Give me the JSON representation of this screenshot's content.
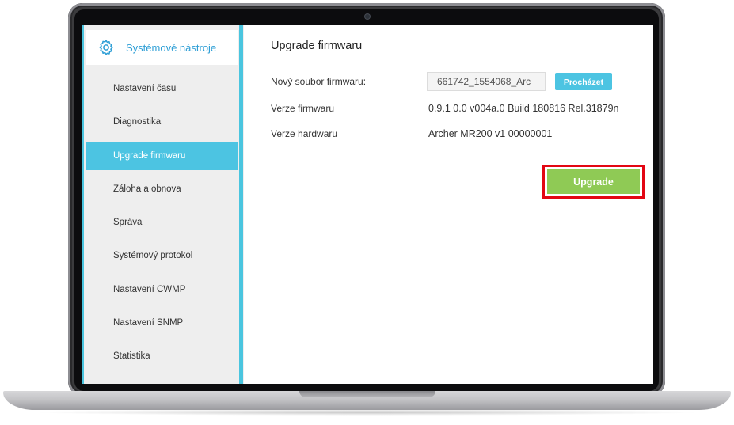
{
  "sidebar": {
    "header_title": "Systémové nástroje",
    "header_icon": "gear-icon",
    "items": [
      {
        "label": "Nastavení času",
        "active": false
      },
      {
        "label": "Diagnostika",
        "active": false
      },
      {
        "label": "Upgrade firmwaru",
        "active": true
      },
      {
        "label": "Záloha a obnova",
        "active": false
      },
      {
        "label": "Správa",
        "active": false
      },
      {
        "label": "Systémový protokol",
        "active": false
      },
      {
        "label": "Nastavení CWMP",
        "active": false
      },
      {
        "label": "Nastavení SNMP",
        "active": false
      },
      {
        "label": "Statistika",
        "active": false
      }
    ]
  },
  "main": {
    "title": "Upgrade firmwaru",
    "new_firmware_label": "Nový soubor firmwaru:",
    "new_firmware_value": "661742_1554068_Arc",
    "browse_label": "Procházet",
    "firmware_version_label": "Verze firmwaru",
    "firmware_version_value": "0.9.1 0.0 v004a.0 Build 180816 Rel.31879n",
    "hardware_version_label": "Verze hardwaru",
    "hardware_version_value": "Archer MR200 v1 00000001",
    "upgrade_label": "Upgrade"
  },
  "colors": {
    "accent": "#4cc4e2",
    "title_text": "#2f9fd6",
    "upgrade_button": "#8fca55",
    "highlight_border": "#e30613"
  }
}
